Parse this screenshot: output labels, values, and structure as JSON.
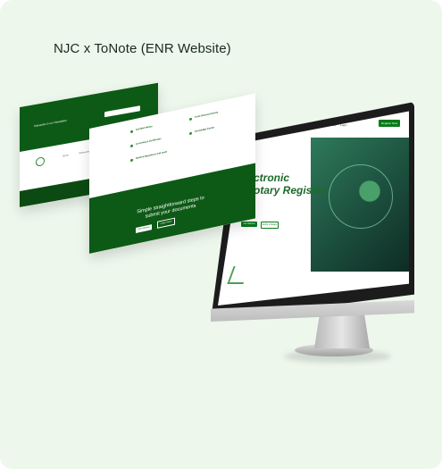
{
  "title": "NJC x ToNote (ENR Website)",
  "colors": {
    "background": "#edf7ec",
    "brand_green": "#0d5a16",
    "accent_green": "#0a7a1a"
  },
  "mockup": {
    "nav_items": [
      "Home",
      "Services",
      "About",
      "Resources",
      "Contact",
      "Login"
    ],
    "nav_button": "Register Now",
    "hero_title_line1": "ctronic",
    "hero_title_line2": "otary Register",
    "hero_button_primary": "Get Started",
    "hero_button_secondary": "Verify a Notary",
    "panel1_heading": "Subscribe to our Newsletter",
    "panel2_cta_line1": "Simple straightforward steps to",
    "panel2_cta_line2": "submit your documents",
    "panel2_button_primary": "Get Started",
    "panel2_button_secondary": "Learn More",
    "features": [
      "Certified Notary",
      "Track Notarial Activity",
      "Licensing & Certificates",
      "Knowledge Center",
      "Notarial Signatures and seals"
    ]
  }
}
